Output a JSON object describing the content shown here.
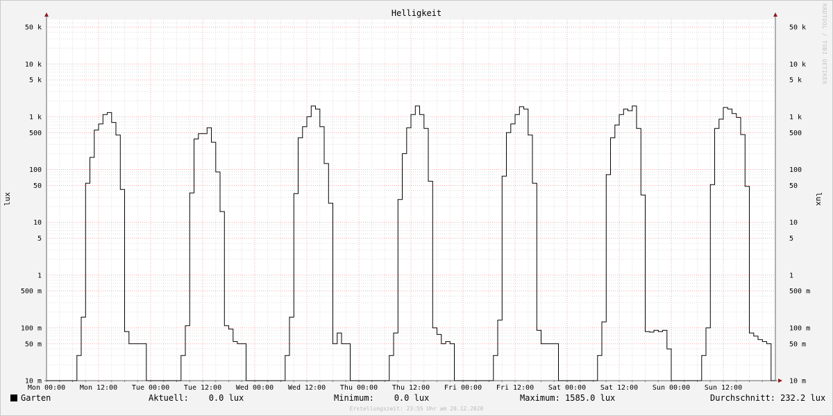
{
  "chart_data": {
    "type": "line",
    "title": "Helligkeit",
    "ylabel": "lux",
    "yscale": "log",
    "ylim": [
      0.01,
      70000
    ],
    "y_ticks": [
      {
        "value": 0.01,
        "label": "10 m"
      },
      {
        "value": 0.05,
        "label": "50 m"
      },
      {
        "value": 0.1,
        "label": "100 m"
      },
      {
        "value": 0.5,
        "label": "500 m"
      },
      {
        "value": 1,
        "label": "1"
      },
      {
        "value": 5,
        "label": "5"
      },
      {
        "value": 10,
        "label": "10"
      },
      {
        "value": 50,
        "label": "50"
      },
      {
        "value": 100,
        "label": "100"
      },
      {
        "value": 500,
        "label": "500"
      },
      {
        "value": 1000,
        "label": "1 k"
      },
      {
        "value": 5000,
        "label": "5 k"
      },
      {
        "value": 10000,
        "label": "10 k"
      },
      {
        "value": 50000,
        "label": "50 k"
      }
    ],
    "x_ticks": [
      "Mon 00:00",
      "Mon 12:00",
      "Tue 00:00",
      "Tue 12:00",
      "Wed 00:00",
      "Wed 12:00",
      "Thu 00:00",
      "Thu 12:00",
      "Fri 00:00",
      "Fri 12:00",
      "Sat 00:00",
      "Sat 12:00",
      "Sun 00:00",
      "Sun 12:00"
    ],
    "x_unit": "hours since Mon 00:00",
    "x_range": [
      0,
      166
    ],
    "grid": true,
    "series": [
      {
        "name": "Garten",
        "color": "#000000",
        "points": [
          [
            0,
            0.01
          ],
          [
            7,
            0.01
          ],
          [
            7,
            0.03
          ],
          [
            8,
            0.03
          ],
          [
            8,
            0.16
          ],
          [
            9,
            0.16
          ],
          [
            9,
            55
          ],
          [
            10,
            55
          ],
          [
            10,
            170
          ],
          [
            11,
            170
          ],
          [
            11,
            560
          ],
          [
            12,
            560
          ],
          [
            12,
            730
          ],
          [
            13,
            730
          ],
          [
            13,
            1100
          ],
          [
            14,
            1100
          ],
          [
            14,
            1200
          ],
          [
            15,
            1200
          ],
          [
            15,
            780
          ],
          [
            16,
            780
          ],
          [
            16,
            450
          ],
          [
            17,
            450
          ],
          [
            17,
            42
          ],
          [
            18,
            42
          ],
          [
            18,
            0.085
          ],
          [
            19,
            0.085
          ],
          [
            19,
            0.05
          ],
          [
            23,
            0.05
          ],
          [
            23,
            0.01
          ],
          [
            31,
            0.01
          ],
          [
            31,
            0.03
          ],
          [
            32,
            0.03
          ],
          [
            32,
            0.11
          ],
          [
            33,
            0.11
          ],
          [
            33,
            36
          ],
          [
            34,
            36
          ],
          [
            34,
            380
          ],
          [
            35,
            380
          ],
          [
            35,
            480
          ],
          [
            37,
            480
          ],
          [
            37,
            620
          ],
          [
            38,
            620
          ],
          [
            38,
            330
          ],
          [
            39,
            330
          ],
          [
            39,
            90
          ],
          [
            40,
            90
          ],
          [
            40,
            16
          ],
          [
            41,
            16
          ],
          [
            41,
            0.11
          ],
          [
            42,
            0.11
          ],
          [
            42,
            0.095
          ],
          [
            43,
            0.095
          ],
          [
            43,
            0.055
          ],
          [
            44,
            0.055
          ],
          [
            44,
            0.05
          ],
          [
            46,
            0.05
          ],
          [
            46,
            0.01
          ],
          [
            55,
            0.01
          ],
          [
            55,
            0.03
          ],
          [
            56,
            0.03
          ],
          [
            56,
            0.16
          ],
          [
            57,
            0.16
          ],
          [
            57,
            35
          ],
          [
            58,
            35
          ],
          [
            58,
            400
          ],
          [
            59,
            400
          ],
          [
            59,
            650
          ],
          [
            60,
            650
          ],
          [
            60,
            1000
          ],
          [
            61,
            1000
          ],
          [
            61,
            1600
          ],
          [
            62,
            1600
          ],
          [
            62,
            1400
          ],
          [
            63,
            1400
          ],
          [
            63,
            650
          ],
          [
            64,
            650
          ],
          [
            64,
            130
          ],
          [
            65,
            130
          ],
          [
            65,
            23
          ],
          [
            66,
            23
          ],
          [
            66,
            0.05
          ],
          [
            67,
            0.05
          ],
          [
            67,
            0.08
          ],
          [
            68,
            0.08
          ],
          [
            68,
            0.05
          ],
          [
            70,
            0.05
          ],
          [
            70,
            0.01
          ],
          [
            79,
            0.01
          ],
          [
            79,
            0.03
          ],
          [
            80,
            0.03
          ],
          [
            80,
            0.08
          ],
          [
            81,
            0.08
          ],
          [
            81,
            27
          ],
          [
            82,
            27
          ],
          [
            82,
            200
          ],
          [
            83,
            200
          ],
          [
            83,
            620
          ],
          [
            84,
            620
          ],
          [
            84,
            1100
          ],
          [
            85,
            1100
          ],
          [
            85,
            1600
          ],
          [
            86,
            1600
          ],
          [
            86,
            1100
          ],
          [
            87,
            1100
          ],
          [
            87,
            600
          ],
          [
            88,
            600
          ],
          [
            88,
            60
          ],
          [
            89,
            60
          ],
          [
            89,
            0.1
          ],
          [
            90,
            0.1
          ],
          [
            90,
            0.075
          ],
          [
            91,
            0.075
          ],
          [
            91,
            0.05
          ],
          [
            92,
            0.05
          ],
          [
            92,
            0.055
          ],
          [
            93,
            0.055
          ],
          [
            93,
            0.05
          ],
          [
            94,
            0.05
          ],
          [
            94,
            0.01
          ],
          [
            103,
            0.01
          ],
          [
            103,
            0.03
          ],
          [
            104,
            0.03
          ],
          [
            104,
            0.14
          ],
          [
            105,
            0.14
          ],
          [
            105,
            75
          ],
          [
            106,
            75
          ],
          [
            106,
            500
          ],
          [
            107,
            500
          ],
          [
            107,
            730
          ],
          [
            108,
            730
          ],
          [
            108,
            1100
          ],
          [
            109,
            1100
          ],
          [
            109,
            1550
          ],
          [
            110,
            1550
          ],
          [
            110,
            1400
          ],
          [
            111,
            1400
          ],
          [
            111,
            450
          ],
          [
            112,
            450
          ],
          [
            112,
            55
          ],
          [
            113,
            55
          ],
          [
            113,
            0.09
          ],
          [
            114,
            0.09
          ],
          [
            114,
            0.05
          ],
          [
            118,
            0.05
          ],
          [
            118,
            0.01
          ],
          [
            127,
            0.01
          ],
          [
            127,
            0.03
          ],
          [
            128,
            0.03
          ],
          [
            128,
            0.13
          ],
          [
            129,
            0.13
          ],
          [
            129,
            80
          ],
          [
            130,
            80
          ],
          [
            130,
            400
          ],
          [
            131,
            400
          ],
          [
            131,
            700
          ],
          [
            132,
            700
          ],
          [
            132,
            1100
          ],
          [
            133,
            1100
          ],
          [
            133,
            1400
          ],
          [
            134,
            1400
          ],
          [
            134,
            1300
          ],
          [
            135,
            1300
          ],
          [
            135,
            1600
          ],
          [
            136,
            1600
          ],
          [
            136,
            600
          ],
          [
            137,
            600
          ],
          [
            137,
            33
          ],
          [
            138,
            33
          ],
          [
            138,
            0.085
          ],
          [
            139,
            0.085
          ],
          [
            139,
            0.083
          ],
          [
            140,
            0.083
          ],
          [
            140,
            0.09
          ],
          [
            141,
            0.09
          ],
          [
            141,
            0.085
          ],
          [
            142,
            0.085
          ],
          [
            142,
            0.09
          ],
          [
            143,
            0.09
          ],
          [
            143,
            0.04
          ],
          [
            144,
            0.04
          ],
          [
            144,
            0.01
          ],
          [
            151,
            0.01
          ],
          [
            151,
            0.03
          ],
          [
            152,
            0.03
          ],
          [
            152,
            0.1
          ],
          [
            153,
            0.1
          ],
          [
            153,
            52
          ],
          [
            154,
            52
          ],
          [
            154,
            600
          ],
          [
            155,
            600
          ],
          [
            155,
            900
          ],
          [
            156,
            900
          ],
          [
            156,
            1500
          ],
          [
            157,
            1500
          ],
          [
            157,
            1400
          ],
          [
            158,
            1400
          ],
          [
            158,
            1150
          ],
          [
            159,
            1150
          ],
          [
            159,
            970
          ],
          [
            160,
            970
          ],
          [
            160,
            460
          ],
          [
            161,
            460
          ],
          [
            161,
            48
          ],
          [
            162,
            48
          ],
          [
            162,
            0.08
          ],
          [
            163,
            0.08
          ],
          [
            163,
            0.07
          ],
          [
            164,
            0.07
          ],
          [
            164,
            0.06
          ],
          [
            165,
            0.06
          ],
          [
            165,
            0.055
          ],
          [
            166,
            0.055
          ],
          [
            166,
            0.05
          ],
          [
            167,
            0.05
          ],
          [
            167,
            0.01
          ],
          [
            168,
            0.01
          ]
        ]
      }
    ]
  },
  "legend": {
    "series_name": "Garten",
    "aktuell": "Aktuell:    0.0 lux",
    "minimum": "Minimum:    0.0 lux",
    "maximum": "Maximum: 1585.0 lux",
    "durchschnitt": "Durchschnitt: 232.2 lux"
  },
  "footer": "Erstellungszeit: 23:55 Uhr am 20.12.2020",
  "watermark": "RRDTOOL / TOBI OETIKER"
}
